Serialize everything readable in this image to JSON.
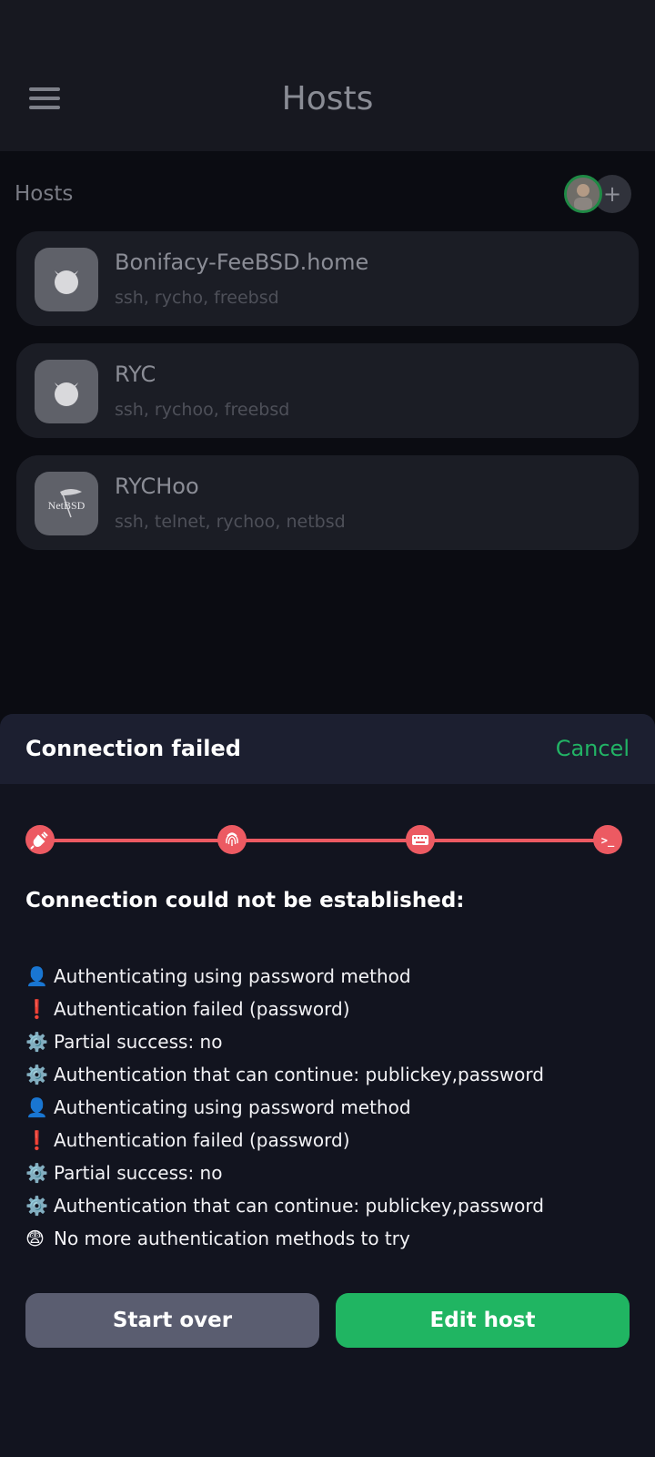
{
  "app": {
    "title": "Hosts",
    "menu_icon": "hamburger-menu-icon"
  },
  "hosts_section": {
    "label": "Hosts",
    "add_label": "+",
    "hosts": [
      {
        "name": "Bonifacy-FeeBSD.home",
        "tags": "ssh, rycho, freebsd",
        "icon": "freebsd-icon"
      },
      {
        "name": "RYC",
        "tags": "ssh, rychoo, freebsd",
        "icon": "freebsd-icon"
      },
      {
        "name": "RYCHoo",
        "tags": "ssh, telnet, rychoo, netbsd",
        "icon": "netbsd-icon",
        "icon_text": "NetBSD"
      }
    ]
  },
  "sheet": {
    "title": "Connection failed",
    "cancel_label": "Cancel",
    "steps": [
      {
        "icon": "plug-icon"
      },
      {
        "icon": "fingerprint-icon"
      },
      {
        "icon": "keyboard-icon"
      },
      {
        "icon": "terminal-icon",
        "text": ">_"
      }
    ],
    "accent_color": "#ec5a62",
    "error_heading": "Connection could not be established:",
    "log": [
      {
        "emoji": "👤",
        "text": "Authenticating using password method"
      },
      {
        "emoji": "❗",
        "text": "Authentication failed (password)"
      },
      {
        "emoji": "⚙️",
        "text": "Partial success: no"
      },
      {
        "emoji": "⚙️",
        "text": "Authentication that can continue: publickey,password"
      },
      {
        "emoji": "👤",
        "text": "Authenticating using password method"
      },
      {
        "emoji": "❗",
        "text": "Authentication failed (password)"
      },
      {
        "emoji": "⚙️",
        "text": "Partial success: no"
      },
      {
        "emoji": "⚙️",
        "text": "Authentication that can continue: publickey,password"
      },
      {
        "emoji": "😨",
        "text": "No more authentication methods to try"
      }
    ],
    "start_over_label": "Start over",
    "edit_host_label": "Edit host",
    "brand_color": "#20b562"
  }
}
